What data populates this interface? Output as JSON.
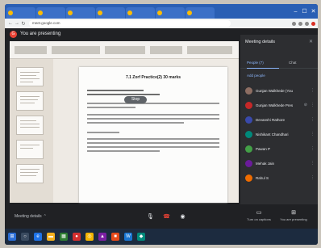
{
  "browser": {
    "tabs": [
      {
        "label": "",
        "active": false
      },
      {
        "label": "",
        "active": false
      },
      {
        "label": "",
        "active": false
      },
      {
        "label": "",
        "active": false
      },
      {
        "label": "",
        "active": true
      },
      {
        "label": "",
        "active": false
      },
      {
        "label": "",
        "active": false
      },
      {
        "label": "",
        "active": false
      }
    ],
    "url": "meet.google.com",
    "controls": {
      "minimize": "–",
      "maximize": "☐",
      "close": "✕"
    }
  },
  "meet": {
    "presenting_text": "You are presenting",
    "document": {
      "heading": "7.1  Zorf Practice(2) 30 marks",
      "share_pill": "Stop"
    },
    "bottom": {
      "meeting_details": "Meeting details",
      "meeting_details_chevron": "⌃",
      "captions_label": "Turn on captions",
      "presenting_label": "You are presenting"
    },
    "panel": {
      "title": "Meeting details",
      "people_tab": "People (7)",
      "chat_tab": "Chat",
      "add_people": "Add people",
      "participants": [
        {
          "name": "Gunjan Walkhede (You)",
          "color": "#8d6e63"
        },
        {
          "name": "Gunjan Walkhede Presentation",
          "color": "#c62828"
        },
        {
          "name": "Devanshi Rathore",
          "color": "#3949ab"
        },
        {
          "name": "Nishikant Chandhari",
          "color": "#00897b"
        },
        {
          "name": "Pawan P",
          "color": "#43a047"
        },
        {
          "name": "Mehak Jain",
          "color": "#6a1b9a"
        },
        {
          "name": "Rahul S",
          "color": "#ef6c00"
        }
      ]
    }
  },
  "taskbar": {
    "search_placeholder": "",
    "time": "",
    "date": ""
  },
  "colors": {
    "accent": "#8ab4f8",
    "end_call": "#ea4335",
    "tabbar": "#2a5fb4"
  }
}
